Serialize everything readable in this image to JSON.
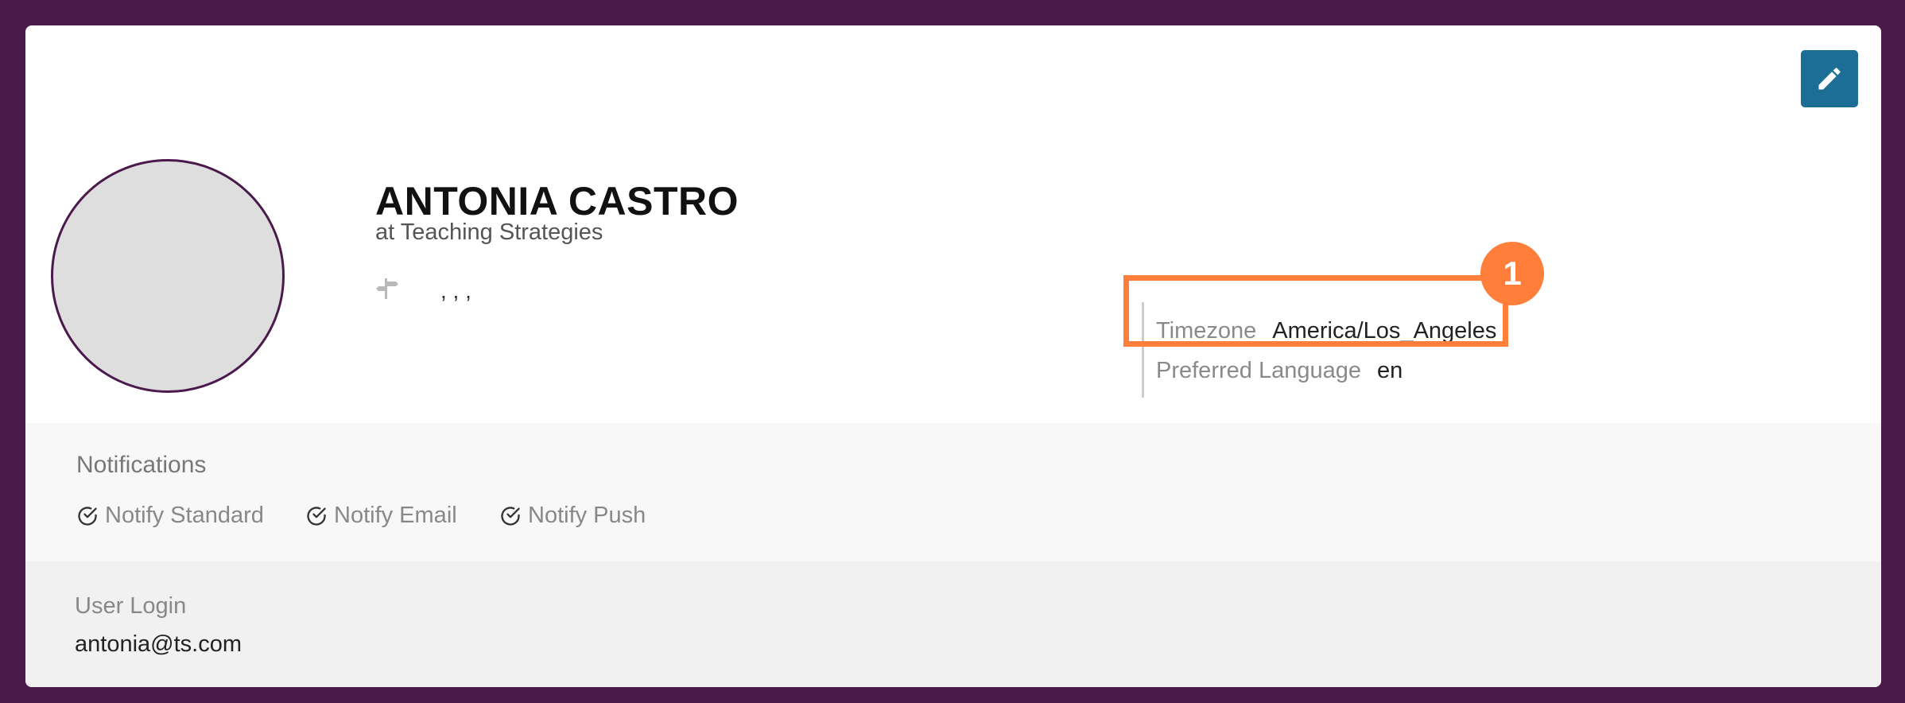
{
  "profile": {
    "name": "ANTONIA CASTRO",
    "organization": "at Teaching Strategies",
    "address": ", , ,"
  },
  "info": {
    "timezone_label": "Timezone",
    "timezone_value": "America/Los_Angeles",
    "language_label": "Preferred Language",
    "language_value": "en"
  },
  "annotation": {
    "badge": "1",
    "color": "#ff7f3a"
  },
  "notifications": {
    "title": "Notifications",
    "items": [
      {
        "label": "Notify Standard"
      },
      {
        "label": "Notify Email"
      },
      {
        "label": "Notify Push"
      }
    ]
  },
  "login": {
    "title": "User Login",
    "value": "antonia@ts.com"
  },
  "colors": {
    "frame": "#4b1a4c",
    "edit_button": "#1d6e97"
  },
  "icons": {
    "edit": "pencil-icon",
    "address": "signpost-icon",
    "check": "check-circle-icon"
  }
}
